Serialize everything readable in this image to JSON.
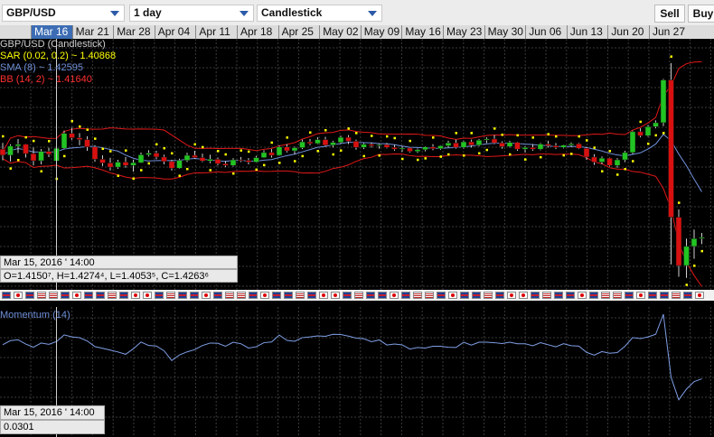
{
  "toolbar": {
    "symbol": "GBP/USD",
    "interval": "1 day",
    "chart_type": "Candlestick",
    "sell_label": "Sell",
    "buy_label": "Buy"
  },
  "date_axis": [
    "Mar 16",
    "Mar 21",
    "Mar 28",
    "Apr 04",
    "Apr 11",
    "Apr 18",
    "Apr 25",
    "May 02",
    "May 09",
    "May 16",
    "May 23",
    "May 30",
    "Jun 06",
    "Jun 13",
    "Jun 20",
    "Jun 27"
  ],
  "selected_date": "Mar 16",
  "legend": {
    "main": "GBP/USD (Candlestick)",
    "sar": "SAR (0.02, 0.2) ~ 1.40868",
    "sma": "SMA (8) ~ 1.42595",
    "bb": "BB (14, 2) ~ 1.41640",
    "momentum": "Momentum (14)"
  },
  "colors": {
    "up": "#22c422",
    "down": "#d81010",
    "sar": "#ffff00",
    "sma": "#6f8fd8",
    "bb": "#e01818",
    "momentum": "#7f9fe6",
    "grid": "#3a3a3a",
    "crosshair": "#cfcfcf"
  },
  "tooltip_main": {
    "time": "Mar 15, 2016 ' 14:00",
    "ohlc": "O=1.4150⁷, H=1.4274⁴, L=1.4053⁵, C=1.4263⁶"
  },
  "tooltip_momentum": {
    "time": "Mar 15, 2016 ' 14:00",
    "value": "0.0301"
  },
  "flag_icons": [
    "uk-flag-icon",
    "us-flag-icon",
    "eu-flag-icon",
    "jp-flag-icon"
  ],
  "chart_data": {
    "type": "candlestick",
    "title": "GBP/USD (Candlestick)",
    "ohlc": [
      [
        1.4255,
        1.4311,
        1.4155,
        1.4201
      ],
      [
        1.4201,
        1.4299,
        1.4145,
        1.4282
      ],
      [
        1.4282,
        1.4345,
        1.422,
        1.4298
      ],
      [
        1.4298,
        1.4302,
        1.418,
        1.4215
      ],
      [
        1.4215,
        1.427,
        1.411,
        1.4152
      ],
      [
        1.4152,
        1.4255,
        1.412,
        1.4235
      ],
      [
        1.4235,
        1.4268,
        1.4184,
        1.421
      ],
      [
        1.415,
        1.4274,
        1.4053,
        1.4263
      ],
      [
        1.4263,
        1.442,
        1.4255,
        1.4395
      ],
      [
        1.4395,
        1.4446,
        1.4339,
        1.4356
      ],
      [
        1.4356,
        1.4398,
        1.429,
        1.434
      ],
      [
        1.434,
        1.437,
        1.424,
        1.4275
      ],
      [
        1.4275,
        1.429,
        1.4143,
        1.4165
      ],
      [
        1.4165,
        1.42,
        1.4105,
        1.4132
      ],
      [
        1.4132,
        1.4178,
        1.4065,
        1.4095
      ],
      [
        1.4095,
        1.416,
        1.408,
        1.414
      ],
      [
        1.414,
        1.4185,
        1.409,
        1.411
      ],
      [
        1.411,
        1.416,
        1.4055,
        1.4135
      ],
      [
        1.4135,
        1.4225,
        1.413,
        1.4205
      ],
      [
        1.4205,
        1.4245,
        1.419,
        1.422
      ],
      [
        1.422,
        1.424,
        1.4165,
        1.4185
      ],
      [
        1.4185,
        1.4205,
        1.412,
        1.4145
      ],
      [
        1.4145,
        1.416,
        1.4065,
        1.4085
      ],
      [
        1.4085,
        1.417,
        1.408,
        1.4155
      ],
      [
        1.4155,
        1.4222,
        1.414,
        1.42
      ],
      [
        1.42,
        1.424,
        1.417,
        1.418
      ],
      [
        1.418,
        1.4215,
        1.414,
        1.415
      ],
      [
        1.415,
        1.4205,
        1.413,
        1.4165
      ],
      [
        1.4165,
        1.418,
        1.411,
        1.4125
      ],
      [
        1.4125,
        1.415,
        1.4095,
        1.411
      ],
      [
        1.411,
        1.4175,
        1.41,
        1.416
      ],
      [
        1.416,
        1.4185,
        1.414,
        1.4155
      ],
      [
        1.4155,
        1.4175,
        1.412,
        1.414
      ],
      [
        1.414,
        1.4195,
        1.4135,
        1.418
      ],
      [
        1.418,
        1.4245,
        1.4175,
        1.4225
      ],
      [
        1.4225,
        1.4255,
        1.418,
        1.42
      ],
      [
        1.42,
        1.4288,
        1.4195,
        1.4275
      ],
      [
        1.4275,
        1.43,
        1.4225,
        1.424
      ],
      [
        1.424,
        1.4278,
        1.421,
        1.4268
      ],
      [
        1.4268,
        1.434,
        1.4255,
        1.432
      ],
      [
        1.432,
        1.4345,
        1.429,
        1.4305
      ],
      [
        1.4305,
        1.436,
        1.43,
        1.434
      ],
      [
        1.434,
        1.4365,
        1.428,
        1.429
      ],
      [
        1.429,
        1.433,
        1.427,
        1.4315
      ],
      [
        1.4315,
        1.4375,
        1.4305,
        1.436
      ],
      [
        1.436,
        1.438,
        1.43,
        1.4325
      ],
      [
        1.4325,
        1.434,
        1.425,
        1.427
      ],
      [
        1.427,
        1.431,
        1.4255,
        1.4298
      ],
      [
        1.4298,
        1.4315,
        1.427,
        1.4285
      ],
      [
        1.4285,
        1.4305,
        1.426,
        1.4295
      ],
      [
        1.4295,
        1.431,
        1.4262,
        1.427
      ],
      [
        1.427,
        1.4295,
        1.424,
        1.4255
      ],
      [
        1.4255,
        1.428,
        1.423,
        1.4265
      ],
      [
        1.4265,
        1.427,
        1.4225,
        1.4235
      ],
      [
        1.4235,
        1.4262,
        1.4222,
        1.425
      ],
      [
        1.425,
        1.4282,
        1.4235,
        1.4275
      ],
      [
        1.4275,
        1.43,
        1.4245,
        1.426
      ],
      [
        1.426,
        1.429,
        1.425,
        1.4285
      ],
      [
        1.4285,
        1.433,
        1.427,
        1.431
      ],
      [
        1.431,
        1.434,
        1.426,
        1.427
      ],
      [
        1.427,
        1.433,
        1.426,
        1.432
      ],
      [
        1.432,
        1.434,
        1.427,
        1.429
      ],
      [
        1.429,
        1.4345,
        1.428,
        1.4335
      ],
      [
        1.4335,
        1.436,
        1.431,
        1.4345
      ],
      [
        1.4345,
        1.438,
        1.43,
        1.431
      ],
      [
        1.431,
        1.4325,
        1.426,
        1.4278
      ],
      [
        1.4278,
        1.433,
        1.427,
        1.4315
      ],
      [
        1.4315,
        1.432,
        1.424,
        1.4255
      ],
      [
        1.4255,
        1.4282,
        1.4225,
        1.427
      ],
      [
        1.427,
        1.43,
        1.424,
        1.4255
      ],
      [
        1.4255,
        1.431,
        1.4245,
        1.43
      ],
      [
        1.43,
        1.433,
        1.427,
        1.4285
      ],
      [
        1.4285,
        1.431,
        1.4255,
        1.427
      ],
      [
        1.427,
        1.4295,
        1.4262,
        1.429
      ],
      [
        1.429,
        1.4315,
        1.4275,
        1.4302
      ],
      [
        1.4302,
        1.431,
        1.4255,
        1.4262
      ],
      [
        1.4262,
        1.4275,
        1.416,
        1.4185
      ],
      [
        1.4185,
        1.421,
        1.4115,
        1.414
      ],
      [
        1.414,
        1.419,
        1.412,
        1.4175
      ],
      [
        1.4175,
        1.418,
        1.41,
        1.411
      ],
      [
        1.411,
        1.4175,
        1.409,
        1.416
      ],
      [
        1.416,
        1.424,
        1.414,
        1.4225
      ],
      [
        1.4225,
        1.442,
        1.421,
        1.441
      ],
      [
        1.441,
        1.444,
        1.436,
        1.4375
      ],
      [
        1.4375,
        1.447,
        1.4365,
        1.4455
      ],
      [
        1.4455,
        1.451,
        1.444,
        1.449
      ],
      [
        1.449,
        1.488,
        1.446,
        1.487
      ],
      [
        1.487,
        1.502,
        1.323,
        1.365
      ],
      [
        1.365,
        1.372,
        1.312,
        1.322
      ],
      [
        1.322,
        1.346,
        1.311,
        1.339
      ],
      [
        1.339,
        1.354,
        1.328,
        1.346
      ],
      [
        1.346,
        1.351,
        1.341,
        1.347
      ]
    ],
    "sar_last": 1.40868,
    "sma_last": 1.42595,
    "bb_last": 1.4164
  }
}
